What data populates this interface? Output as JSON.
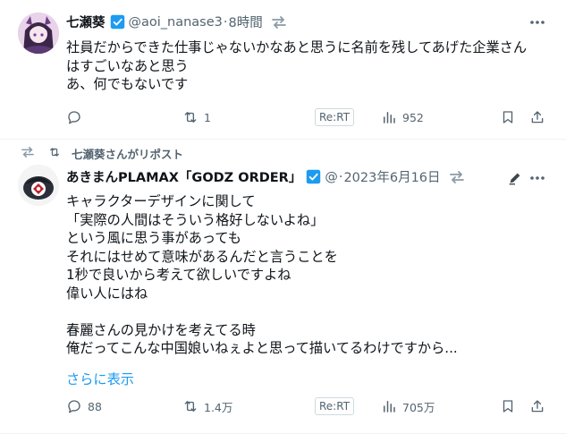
{
  "tweets": [
    {
      "author": "七瀬葵",
      "handle": "@aoi_nanase3",
      "sep": "·",
      "time": "8時間",
      "lines": [
        "社員だからできた仕事じゃないかなあと思うに名前を残してあげた企業さん",
        "はすごいなあと思う",
        "あ、何でもないです"
      ],
      "actions": {
        "reply_count": "",
        "repost_count": "1",
        "rert_label": "Re:RT",
        "views_count": "952"
      }
    },
    {
      "reposted_by": "七瀬葵さんがリポスト",
      "author": "あきまんPLAMAX「GODZ ORDER」",
      "handle": "@",
      "sep": "·",
      "time": "2023年6月16日",
      "lines": [
        "キャラクターデザインに関して",
        "「実際の人間はそういう格好しないよね」",
        "という風に思う事があっても",
        "それにはせめて意味があるんだと言うことを",
        "1秒で良いから考えて欲しいですよね",
        "偉い人にはね",
        "",
        "春麗さんの見かけを考えてる時",
        "俺だってこんな中国娘いねぇよと思って描いてるわけですから..."
      ],
      "show_more": "さらに表示",
      "actions": {
        "reply_count": "88",
        "repost_count": "1.4万",
        "rert_label": "Re:RT",
        "views_count": "705万"
      }
    }
  ],
  "icons": {
    "verified": "verified-badge-icon",
    "swap": "swap-arrows-icon",
    "more": "more-dots-icon",
    "reply": "reply-icon",
    "repost": "repost-icon",
    "views": "views-bar-icon",
    "bookmark": "bookmark-icon",
    "share": "share-icon",
    "pen": "pen-icon"
  },
  "colors": {
    "verified_blue": "#1d9bf0",
    "link_blue": "#1d9bf0",
    "muted_gray": "#536471",
    "text": "#0f1419"
  }
}
